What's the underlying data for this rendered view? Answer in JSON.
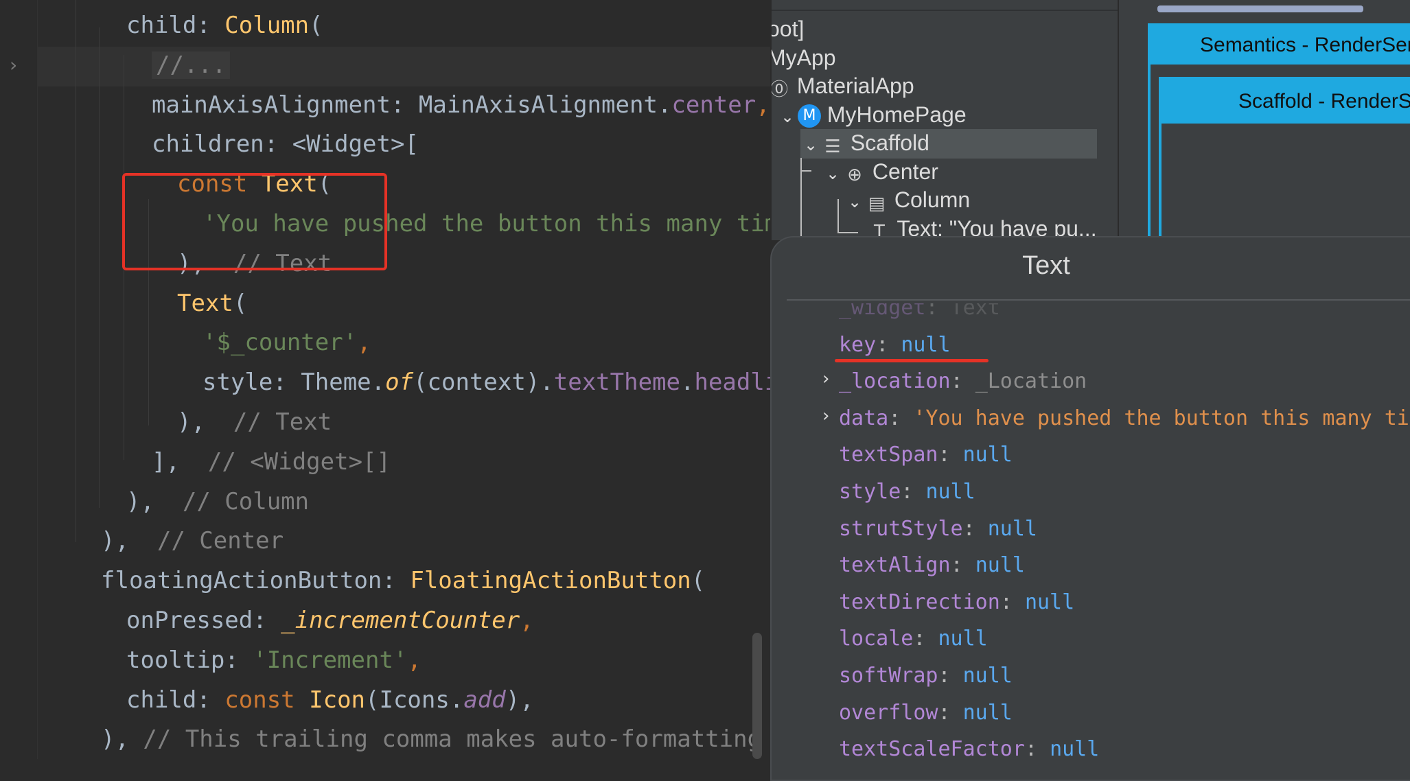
{
  "editor": {
    "lines": [
      {
        "indent": 4,
        "parts": [
          {
            "t": "child: ",
            "c": "plain"
          },
          {
            "t": "Column",
            "c": "cls"
          },
          {
            "t": "(",
            "c": "plain"
          }
        ]
      },
      {
        "indent": 5,
        "parts": [
          {
            "t": "//...",
            "c": "cmt",
            "bg": true
          }
        ]
      },
      {
        "indent": 5,
        "parts": [
          {
            "t": "mainAxisAlignment: MainAxisAlignment.",
            "c": "plain"
          },
          {
            "t": "center",
            "c": "prop"
          },
          {
            "t": ",",
            "c": "kw"
          }
        ]
      },
      {
        "indent": 5,
        "parts": [
          {
            "t": "children: <Widget>[",
            "c": "plain"
          }
        ]
      },
      {
        "indent": 6,
        "parts": [
          {
            "t": "const ",
            "c": "kw"
          },
          {
            "t": "Text",
            "c": "cls"
          },
          {
            "t": "(",
            "c": "plain"
          }
        ]
      },
      {
        "indent": 7,
        "parts": [
          {
            "t": "'You have pushed the button this many times:'",
            "c": "str"
          }
        ]
      },
      {
        "indent": 6,
        "parts": [
          {
            "t": "), ",
            "c": "plain"
          },
          {
            "t": " // Text",
            "c": "cmt"
          }
        ]
      },
      {
        "indent": 6,
        "parts": [
          {
            "t": "Text",
            "c": "cls"
          },
          {
            "t": "(",
            "c": "plain"
          }
        ]
      },
      {
        "indent": 7,
        "parts": [
          {
            "t": "'$_counter'",
            "c": "str"
          },
          {
            "t": ",",
            "c": "kw"
          }
        ]
      },
      {
        "indent": 7,
        "parts": [
          {
            "t": "style: Theme.",
            "c": "plain"
          },
          {
            "t": "of",
            "c": "cls ital"
          },
          {
            "t": "(context).",
            "c": "plain"
          },
          {
            "t": "textTheme",
            "c": "prop"
          },
          {
            "t": ".",
            "c": "plain"
          },
          {
            "t": "headlineMedium",
            "c": "prop"
          }
        ]
      },
      {
        "indent": 6,
        "parts": [
          {
            "t": "), ",
            "c": "plain"
          },
          {
            "t": " // Text",
            "c": "cmt"
          }
        ]
      },
      {
        "indent": 5,
        "parts": [
          {
            "t": "], ",
            "c": "plain"
          },
          {
            "t": " // <Widget>[]",
            "c": "cmt"
          }
        ]
      },
      {
        "indent": 4,
        "parts": [
          {
            "t": "), ",
            "c": "plain"
          },
          {
            "t": " // Column",
            "c": "cmt"
          }
        ]
      },
      {
        "indent": 3,
        "parts": [
          {
            "t": "), ",
            "c": "plain"
          },
          {
            "t": " // Center",
            "c": "cmt"
          }
        ]
      },
      {
        "indent": 3,
        "parts": [
          {
            "t": "floatingActionButton: ",
            "c": "plain"
          },
          {
            "t": "FloatingActionButton",
            "c": "cls"
          },
          {
            "t": "(",
            "c": "plain"
          }
        ]
      },
      {
        "indent": 4,
        "parts": [
          {
            "t": "onPressed: ",
            "c": "plain"
          },
          {
            "t": "_incrementCounter",
            "c": "cls ital"
          },
          {
            "t": ",",
            "c": "kw"
          }
        ]
      },
      {
        "indent": 4,
        "parts": [
          {
            "t": "tooltip: ",
            "c": "plain"
          },
          {
            "t": "'Increment'",
            "c": "str"
          },
          {
            "t": ",",
            "c": "kw"
          }
        ]
      },
      {
        "indent": 4,
        "parts": [
          {
            "t": "child: ",
            "c": "plain"
          },
          {
            "t": "const ",
            "c": "kw"
          },
          {
            "t": "Icon",
            "c": "cls"
          },
          {
            "t": "(Icons.",
            "c": "plain"
          },
          {
            "t": "add",
            "c": "prop ital"
          },
          {
            "t": "),",
            "c": "plain"
          }
        ]
      },
      {
        "indent": 3,
        "parts": [
          {
            "t": "), ",
            "c": "plain"
          },
          {
            "t": "// This trailing comma makes auto-formatting nicer for build methods.",
            "c": "cmt"
          }
        ]
      }
    ]
  },
  "tree": {
    "nodes": [
      {
        "label": "oot]",
        "icon": "",
        "chev": "",
        "selected": false
      },
      {
        "label": "MyApp",
        "icon": "",
        "chev": "",
        "selected": false
      },
      {
        "label": "MaterialApp",
        "icon": "material-app-icon",
        "chev": "",
        "selected": false
      },
      {
        "label": "MyHomePage",
        "icon": "m-badge-icon",
        "chev": "⌄",
        "selected": false
      },
      {
        "label": "Scaffold",
        "icon": "scaffold-icon",
        "chev": "⌄",
        "selected": true
      },
      {
        "label": "Center",
        "icon": "center-icon",
        "chev": "⌄",
        "selected": false
      },
      {
        "label": "Column",
        "icon": "column-icon",
        "chev": "⌄",
        "selected": false
      },
      {
        "label": "Text: \"You have pu...",
        "icon": "text-icon",
        "chev": "",
        "selected": false
      }
    ],
    "m_badge": "M"
  },
  "layout_explorer": {
    "outer_label": "Semantics - RenderSemantics",
    "inner_label": "Scaffold - RenderScaffold"
  },
  "properties": {
    "title": "Text",
    "rows": [
      {
        "key": "_widget",
        "value": "Text",
        "type": "truncated",
        "expandable": false
      },
      {
        "key": "key",
        "value": "null",
        "type": "null",
        "expandable": false
      },
      {
        "key": "_location",
        "value": "_Location",
        "type": "type",
        "expandable": true
      },
      {
        "key": "data",
        "value": "'You have pushed the button this many times:'",
        "type": "string",
        "expandable": true
      },
      {
        "key": "textSpan",
        "value": "null",
        "type": "null",
        "expandable": false
      },
      {
        "key": "style",
        "value": "null",
        "type": "null",
        "expandable": false
      },
      {
        "key": "strutStyle",
        "value": "null",
        "type": "null",
        "expandable": false
      },
      {
        "key": "textAlign",
        "value": "null",
        "type": "null",
        "expandable": false
      },
      {
        "key": "textDirection",
        "value": "null",
        "type": "null",
        "expandable": false
      },
      {
        "key": "locale",
        "value": "null",
        "type": "null",
        "expandable": false
      },
      {
        "key": "softWrap",
        "value": "null",
        "type": "null",
        "expandable": false
      },
      {
        "key": "overflow",
        "value": "null",
        "type": "null",
        "expandable": false
      },
      {
        "key": "textScaleFactor",
        "value": "null",
        "type": "null",
        "expandable": false
      }
    ]
  },
  "colors": {
    "highlight_red": "#e53226",
    "selection_blue": "#1fa9e0"
  }
}
